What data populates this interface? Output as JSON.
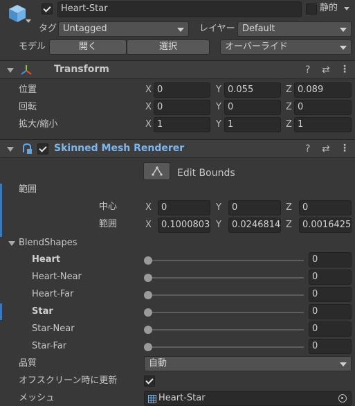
{
  "object": {
    "name": "Heart-Star",
    "static_label": "静的",
    "tag_label": "タグ",
    "tag_value": "Untagged",
    "layer_label": "レイヤー",
    "layer_value": "Default",
    "model_label": "モデル",
    "open_btn": "開く",
    "select_btn": "選択",
    "override_value": "オーバーライド"
  },
  "transform": {
    "title": "Transform",
    "rows": [
      {
        "label": "位置",
        "x": "0",
        "y": "0.055",
        "z": "0.089"
      },
      {
        "label": "回転",
        "x": "0",
        "y": "0",
        "z": "0"
      },
      {
        "label": "拡大/縮小",
        "x": "1",
        "y": "1",
        "z": "1"
      }
    ],
    "axes": {
      "x": "X",
      "y": "Y",
      "z": "Z"
    }
  },
  "renderer": {
    "title": "Skinned Mesh Renderer",
    "edit_bounds": "Edit Bounds",
    "bounds_label": "範囲",
    "center_label": "中心",
    "center": {
      "x": "0",
      "y": "0",
      "z": "0"
    },
    "extent_label": "範囲",
    "extent": {
      "x": "0.1000803",
      "y": "0.0246814",
      "z": "0.0016425"
    },
    "blendshapes_label": "BlendShapes",
    "blendshapes": [
      {
        "name": "Heart",
        "value": "0"
      },
      {
        "name": "Heart-Near",
        "value": "0"
      },
      {
        "name": "Heart-Far",
        "value": "0"
      },
      {
        "name": "Star",
        "value": "0"
      },
      {
        "name": "Star-Near",
        "value": "0"
      },
      {
        "name": "Star-Far",
        "value": "0"
      }
    ],
    "quality_label": "品質",
    "quality_value": "自動",
    "offscreen_label": "オフスクリーン時に更新",
    "mesh_label": "メッシュ",
    "mesh_value": "Heart-Star"
  }
}
